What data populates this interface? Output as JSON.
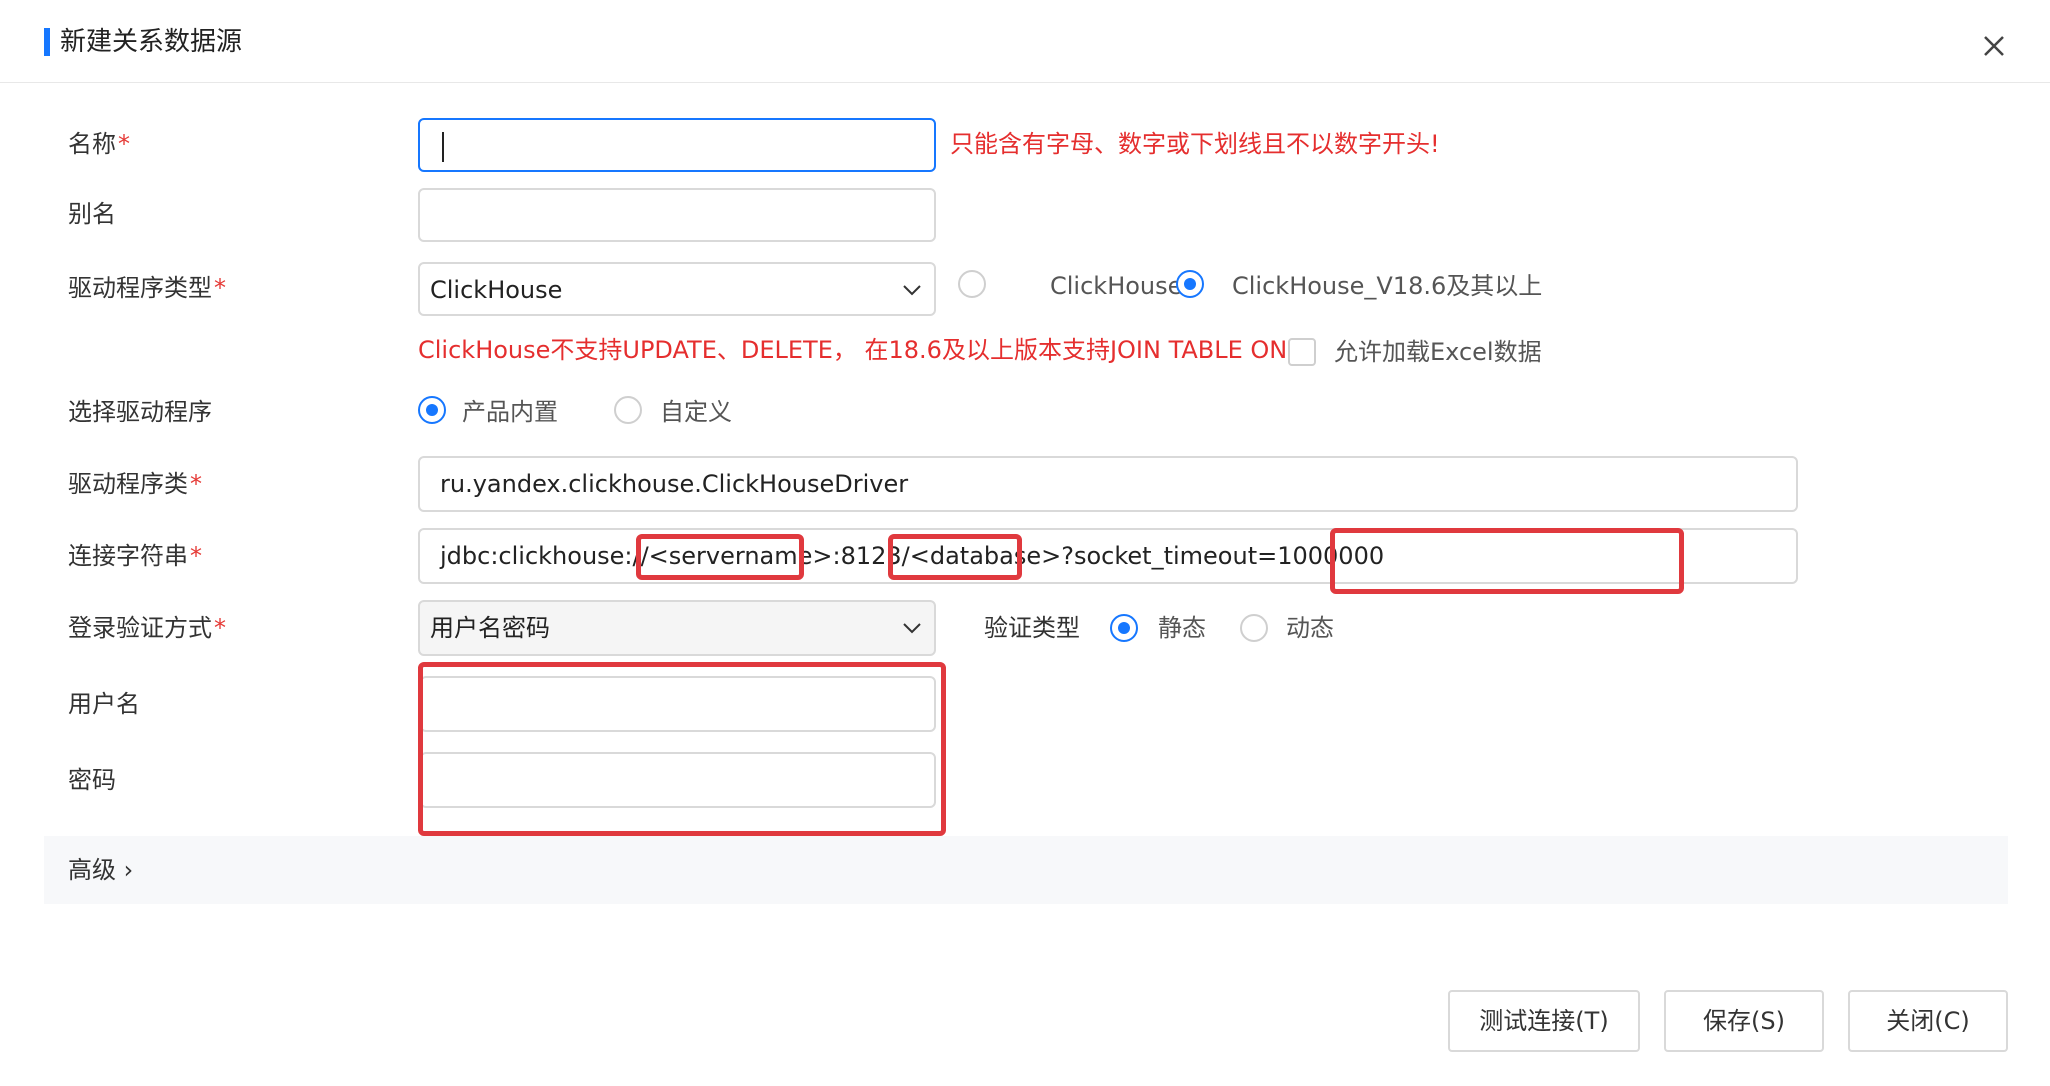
{
  "dialog": {
    "title": "新建关系数据源",
    "accent_color": "#1677ff",
    "close_icon": "close-icon"
  },
  "form": {
    "name": {
      "label": "名称",
      "required": "*",
      "value": "",
      "error": "只能含有字母、数字或下划线且不以数字开头!"
    },
    "alias": {
      "label": "别名",
      "value": ""
    },
    "driver_type": {
      "label": "驱动程序类型",
      "required": "*",
      "selected": "ClickHouse",
      "option1": "ClickHouse",
      "option2": "ClickHouse_V18.6及其以上",
      "selected_option": "ClickHouse_V18.6及其以上",
      "note": "ClickHouse不支持UPDATE、DELETE， 在18.6及以上版本支持JOIN TABLE ON",
      "excel_label": "允许加载Excel数据",
      "excel_checked": false
    },
    "driver_select": {
      "label": "选择驱动程序",
      "option1": "产品内置",
      "option2": "自定义",
      "selected_option": "产品内置"
    },
    "driver_class": {
      "label": "驱动程序类",
      "required": "*",
      "value": "ru.yandex.clickhouse.ClickHouseDriver"
    },
    "connection_string": {
      "label": "连接字符串",
      "required": "*",
      "value": "jdbc:clickhouse://<servername>:8123/<database>?socket_timeout=1000000"
    },
    "auth_method": {
      "label": "登录验证方式",
      "required": "*",
      "selected": "用户名密码",
      "verify_type_label": "验证类型",
      "option1": "静态",
      "option2": "动态",
      "selected_option": "静态"
    },
    "username": {
      "label": "用户名",
      "value": ""
    },
    "password": {
      "label": "密码",
      "value": ""
    },
    "advanced": {
      "label": "高级 ›"
    }
  },
  "footer": {
    "test_label": "测试连接(T)",
    "save_label": "保存(S)",
    "close_label": "关闭(C)"
  },
  "colors": {
    "error": "#e52e2e",
    "highlight": "#e0393e",
    "primary": "#1677ff"
  }
}
